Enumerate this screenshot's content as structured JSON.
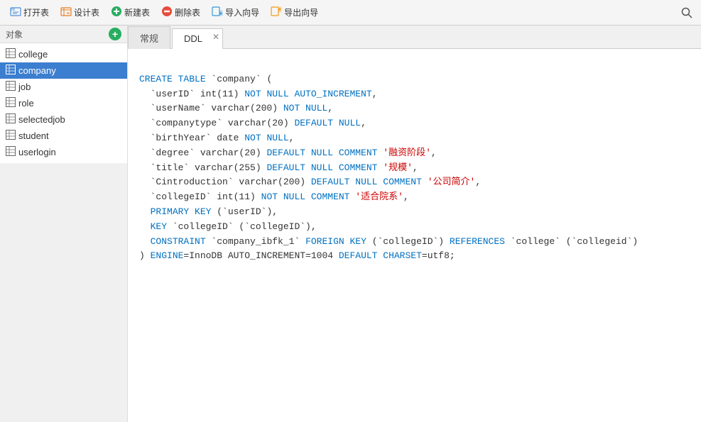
{
  "toolbar": {
    "open_label": "打开表",
    "design_label": "设计表",
    "new_label": "新建表",
    "delete_label": "删除表",
    "import_label": "导入向导",
    "export_label": "导出向导"
  },
  "sidebar": {
    "label": "对象",
    "tables": [
      {
        "name": "college",
        "active": false
      },
      {
        "name": "company",
        "active": true
      },
      {
        "name": "job",
        "active": false
      },
      {
        "name": "role",
        "active": false
      },
      {
        "name": "selectedjob",
        "active": false
      },
      {
        "name": "student",
        "active": false
      },
      {
        "name": "userlogin",
        "active": false
      }
    ]
  },
  "tabs": [
    {
      "label": "常规",
      "active": false
    },
    {
      "label": "DDL",
      "active": true
    }
  ],
  "ddl": {
    "lines": [
      {
        "type": "keyword",
        "text": "CREATE TABLE `company` ("
      },
      {
        "type": "field",
        "backtick": "userID",
        "rest": " int(11) NOT NULL AUTO_INCREMENT,"
      },
      {
        "type": "field",
        "backtick": "userName",
        "rest": " varchar(200) NOT NULL,"
      },
      {
        "type": "field",
        "backtick": "companytype",
        "rest": " varchar(20) DEFAULT NULL,"
      },
      {
        "type": "field",
        "backtick": "birthYear",
        "rest": " date NOT NULL,"
      },
      {
        "type": "field_comment",
        "backtick": "degree",
        "rest": " varchar(20) DEFAULT NULL COMMENT ",
        "comment": "'融资阶段'",
        "comma": ","
      },
      {
        "type": "field_comment",
        "backtick": "title",
        "rest": " varchar(255) DEFAULT NULL COMMENT ",
        "comment": "'规模'",
        "comma": ","
      },
      {
        "type": "field_comment",
        "backtick": "Cintroduction",
        "rest": " varchar(200) DEFAULT NULL COMMENT ",
        "comment": "'公司简介'",
        "comma": ","
      },
      {
        "type": "field_comment",
        "backtick": "collegeID",
        "rest": " int(11) NOT NULL COMMENT ",
        "comment": "'适合院系'",
        "comma": ","
      },
      {
        "type": "primary",
        "text": "PRIMARY KEY (`userID`),"
      },
      {
        "type": "key",
        "text": "KEY `collegeID` (`collegeID`),"
      },
      {
        "type": "constraint",
        "text": "CONSTRAINT `company_ibfk_1` FOREIGN KEY (`collegeID`) REFERENCES `college` (`collegeid`)"
      },
      {
        "type": "engine",
        "text": ") ENGINE=InnoDB AUTO_INCREMENT=1004 DEFAULT CHARSET=utf8;"
      }
    ]
  },
  "colors": {
    "keyword_blue": "#0070c1",
    "string_red": "#cc0000",
    "active_tab_bg": "#3c7ecf"
  }
}
